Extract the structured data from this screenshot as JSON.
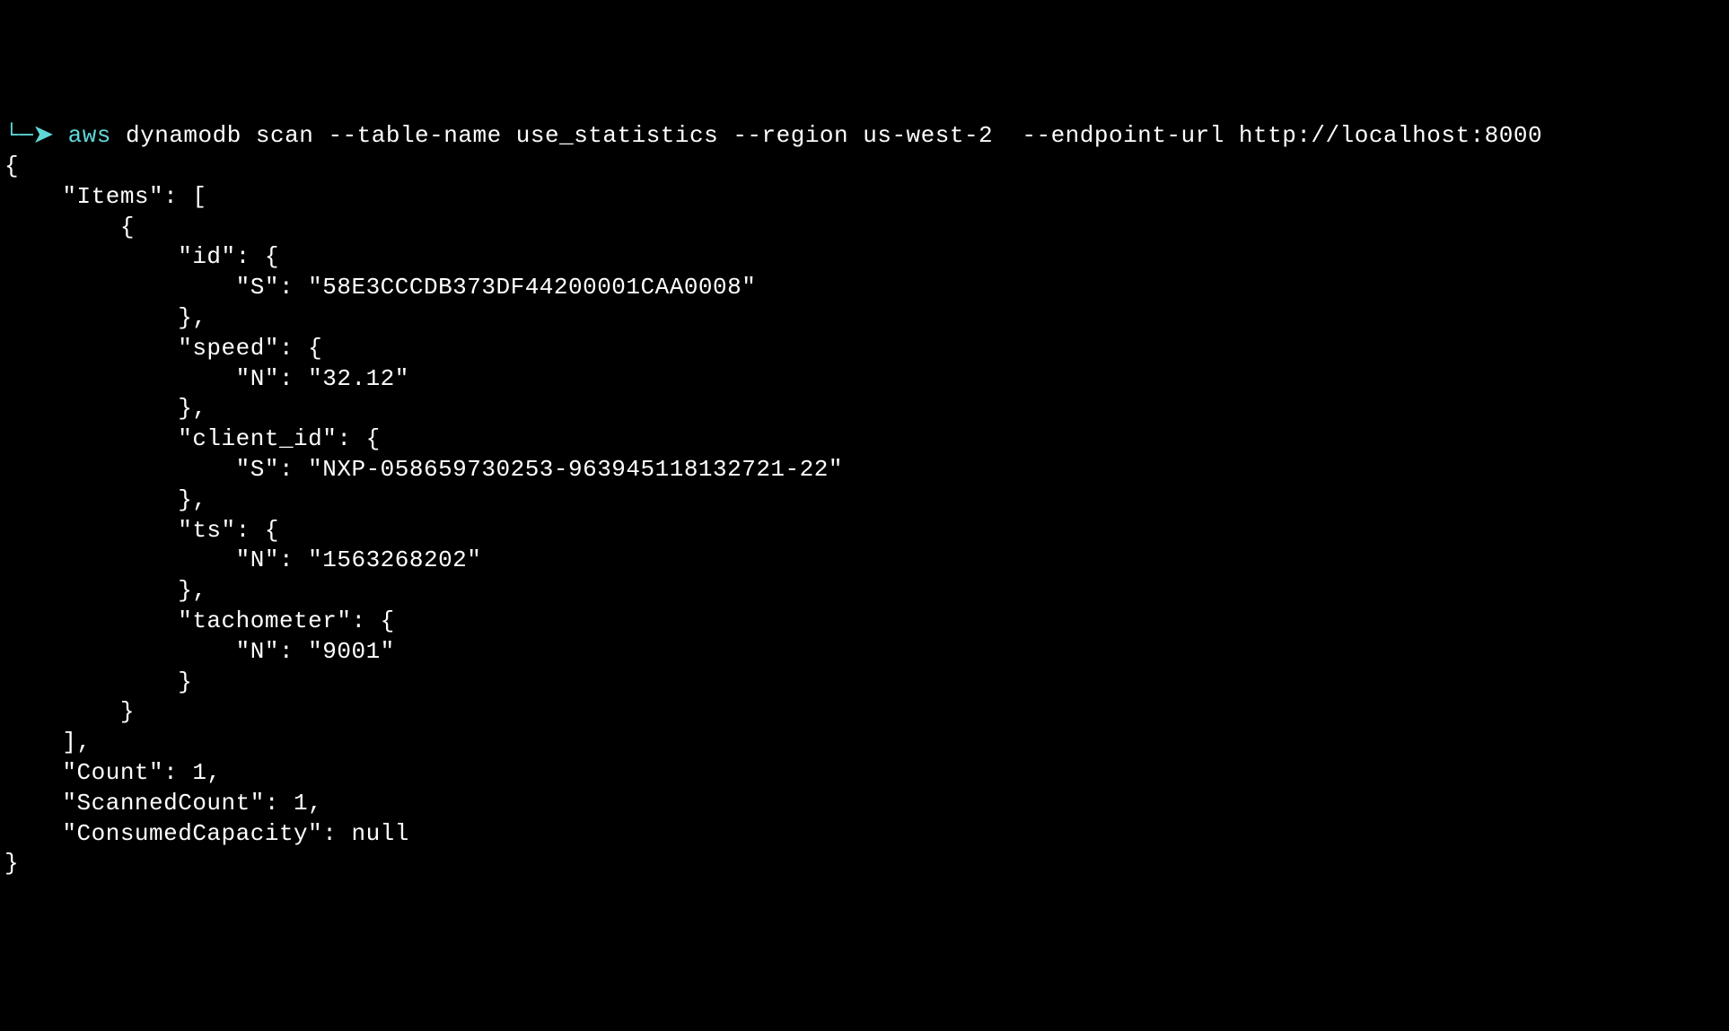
{
  "prompt": {
    "arrow": "└─➤ ",
    "command_aws": "aws",
    "command_rest": " dynamodb scan --table-name use_statistics --region us-west-2  --endpoint-url http://localhost:8000"
  },
  "output": {
    "line1": "{",
    "line2": "    \"Items\": [",
    "line3": "        {",
    "line4": "            \"id\": {",
    "line5": "                \"S\": \"58E3CCCDB373DF44200001CAA0008\"",
    "line6": "            },",
    "line7": "            \"speed\": {",
    "line8": "                \"N\": \"32.12\"",
    "line9": "            },",
    "line10": "            \"client_id\": {",
    "line11": "                \"S\": \"NXP-058659730253-963945118132721-22\"",
    "line12": "            },",
    "line13": "            \"ts\": {",
    "line14": "                \"N\": \"1563268202\"",
    "line15": "            },",
    "line16": "            \"tachometer\": {",
    "line17": "                \"N\": \"9001\"",
    "line18": "            }",
    "line19": "        }",
    "line20": "    ],",
    "line21": "    \"Count\": 1,",
    "line22": "    \"ScannedCount\": 1,",
    "line23": "    \"ConsumedCapacity\": null",
    "line24": "}"
  }
}
